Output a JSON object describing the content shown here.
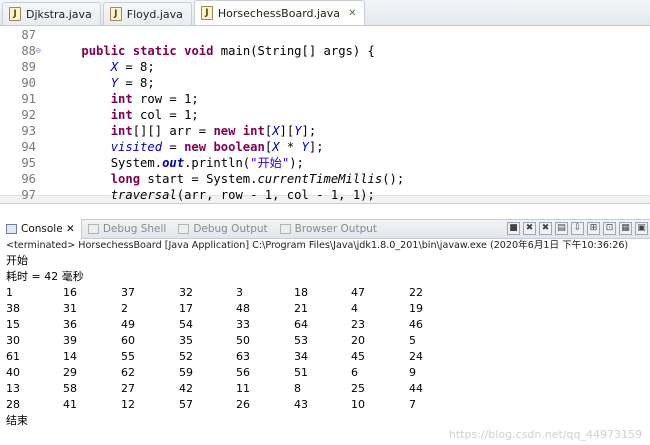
{
  "editor_tabs": [
    {
      "label": "Djkstra.java"
    },
    {
      "label": "Floyd.java"
    },
    {
      "label": "HorsechessBoard.java",
      "active": true
    }
  ],
  "code_lines": [
    {
      "num": "87",
      "fold": "",
      "tokens": []
    },
    {
      "num": "88",
      "fold": "⊖",
      "tokens": [
        {
          "t": "    "
        },
        {
          "t": "public",
          "c": "kw"
        },
        {
          "t": " "
        },
        {
          "t": "static",
          "c": "kw"
        },
        {
          "t": " "
        },
        {
          "t": "void",
          "c": "kw"
        },
        {
          "t": " main(String[] args) {"
        }
      ]
    },
    {
      "num": "89",
      "fold": "",
      "tokens": [
        {
          "t": "        "
        },
        {
          "t": "X",
          "c": "fld"
        },
        {
          "t": " = 8;"
        }
      ]
    },
    {
      "num": "90",
      "fold": "",
      "tokens": [
        {
          "t": "        "
        },
        {
          "t": "Y",
          "c": "fld"
        },
        {
          "t": " = 8;"
        }
      ]
    },
    {
      "num": "91",
      "fold": "",
      "tokens": [
        {
          "t": "        "
        },
        {
          "t": "int",
          "c": "kw"
        },
        {
          "t": " row = 1;"
        }
      ]
    },
    {
      "num": "92",
      "fold": "",
      "tokens": [
        {
          "t": "        "
        },
        {
          "t": "int",
          "c": "kw"
        },
        {
          "t": " col = 1;"
        }
      ]
    },
    {
      "num": "93",
      "fold": "",
      "tokens": [
        {
          "t": "        "
        },
        {
          "t": "int",
          "c": "kw"
        },
        {
          "t": "[][] arr = "
        },
        {
          "t": "new",
          "c": "kw"
        },
        {
          "t": " "
        },
        {
          "t": "int",
          "c": "kw"
        },
        {
          "t": "["
        },
        {
          "t": "X",
          "c": "fld"
        },
        {
          "t": "]["
        },
        {
          "t": "Y",
          "c": "fld"
        },
        {
          "t": "];"
        }
      ]
    },
    {
      "num": "94",
      "fold": "",
      "tokens": [
        {
          "t": "        "
        },
        {
          "t": "visited",
          "c": "fld"
        },
        {
          "t": " = "
        },
        {
          "t": "new",
          "c": "kw"
        },
        {
          "t": " "
        },
        {
          "t": "boolean",
          "c": "kw"
        },
        {
          "t": "["
        },
        {
          "t": "X",
          "c": "fld"
        },
        {
          "t": " * "
        },
        {
          "t": "Y",
          "c": "fld"
        },
        {
          "t": "];"
        }
      ]
    },
    {
      "num": "95",
      "fold": "",
      "tokens": [
        {
          "t": "        System."
        },
        {
          "t": "out",
          "c": "sfld"
        },
        {
          "t": ".println("
        },
        {
          "t": "\"开始\"",
          "c": "str"
        },
        {
          "t": ");"
        }
      ]
    },
    {
      "num": "96",
      "fold": "",
      "tokens": [
        {
          "t": "        "
        },
        {
          "t": "long",
          "c": "kw"
        },
        {
          "t": " start = System."
        },
        {
          "t": "currentTimeMillis",
          "c": "smeth"
        },
        {
          "t": "();"
        }
      ]
    },
    {
      "num": "97",
      "fold": "",
      "tokens": [
        {
          "t": "        "
        },
        {
          "t": "traversal",
          "c": "smeth"
        },
        {
          "t": "(arr, row - 1, col - 1, 1);"
        }
      ]
    }
  ],
  "console_tabs": [
    {
      "label": "Console ✕",
      "active": true,
      "icon": "console-icon"
    },
    {
      "label": "Debug Shell",
      "icon": "debug-shell-icon"
    },
    {
      "label": "Debug Output",
      "icon": "debug-output-icon"
    },
    {
      "label": "Browser Output",
      "icon": "browser-output-icon"
    }
  ],
  "toolbar_buttons": [
    {
      "glyph": "■",
      "icon": "terminate-icon"
    },
    {
      "glyph": "✖",
      "icon": "remove-launch-icon"
    },
    {
      "glyph": "✖",
      "icon": "remove-all-icon"
    },
    {
      "glyph": "▤",
      "icon": "clear-console-icon"
    },
    {
      "glyph": "⇩",
      "icon": "scroll-lock-icon"
    },
    {
      "glyph": "⊞",
      "icon": "word-wrap-icon"
    },
    {
      "glyph": "⊡",
      "icon": "show-console-icon"
    },
    {
      "glyph": "▦",
      "icon": "display-selected-console-icon"
    },
    {
      "glyph": "▣",
      "icon": "open-console-icon"
    }
  ],
  "console": {
    "terminated": "<terminated> HorsechessBoard [Java Application] C:\\Program Files\\Java\\jdk1.8.0_201\\bin\\javaw.exe (2020年6月1日 下午10:36:26)",
    "start_line": "开始",
    "elapsed_line": "耗时 = 42 毫秒",
    "board": [
      [
        "1",
        "16",
        "37",
        "32",
        "3",
        "18",
        "47",
        "22"
      ],
      [
        "38",
        "31",
        "2",
        "17",
        "48",
        "21",
        "4",
        "19"
      ],
      [
        "15",
        "36",
        "49",
        "54",
        "33",
        "64",
        "23",
        "46"
      ],
      [
        "30",
        "39",
        "60",
        "35",
        "50",
        "53",
        "20",
        "5"
      ],
      [
        "61",
        "14",
        "55",
        "52",
        "63",
        "34",
        "45",
        "24"
      ],
      [
        "40",
        "29",
        "62",
        "59",
        "56",
        "51",
        "6",
        "9"
      ],
      [
        "13",
        "58",
        "27",
        "42",
        "11",
        "8",
        "25",
        "44"
      ],
      [
        "28",
        "41",
        "12",
        "57",
        "26",
        "43",
        "10",
        "7"
      ]
    ],
    "end_line": "结束"
  },
  "watermark": "https://blog.csdn.net/qq_44973159"
}
